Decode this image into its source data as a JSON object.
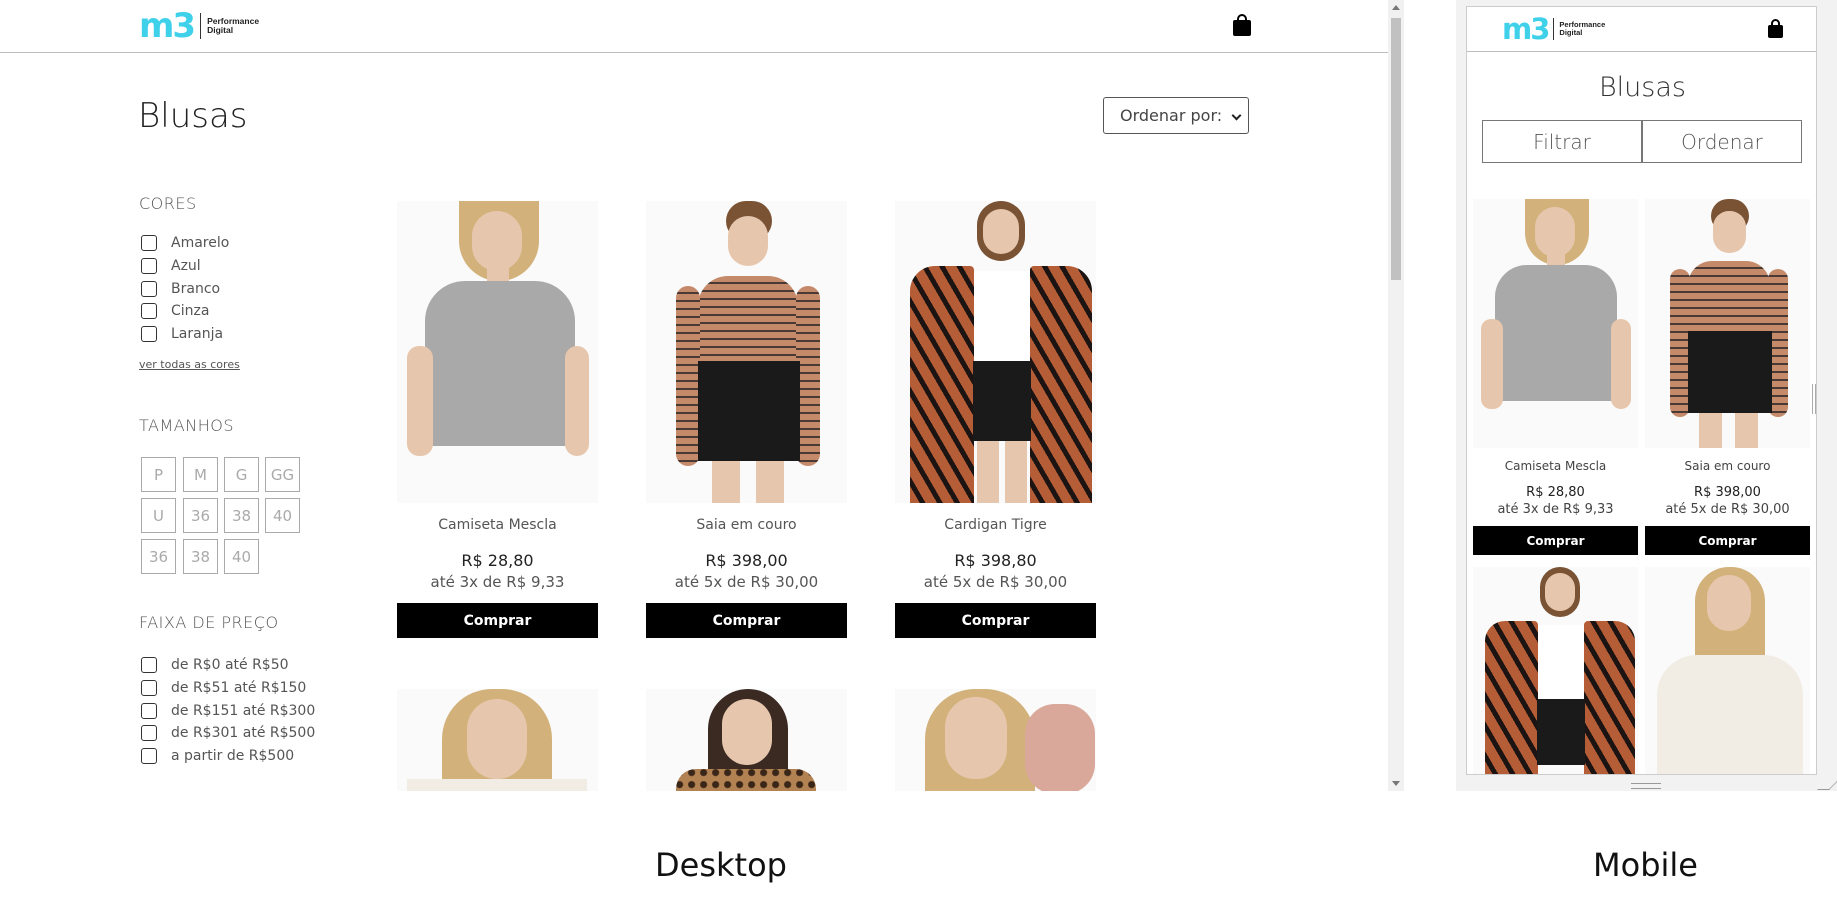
{
  "logo": {
    "mark": "m3",
    "line1": "Performance",
    "line2": "Digital"
  },
  "icons": {
    "bag": "shopping-bag-icon",
    "chevron": "chevron-down-icon"
  },
  "desktop": {
    "title": "Blusas",
    "sort_label": "Ordenar por:",
    "colors": {
      "heading": "CORES",
      "options": [
        "Amarelo",
        "Azul",
        "Branco",
        "Cinza",
        "Laranja"
      ],
      "see_all": "ver todas as cores"
    },
    "sizes": {
      "heading": "TAMANHOS",
      "options": [
        "P",
        "M",
        "G",
        "GG",
        "U",
        "36",
        "38",
        "40",
        "36",
        "38",
        "40"
      ]
    },
    "price": {
      "heading": "FAIXA DE PREÇO",
      "options": [
        "de R$0 até R$50",
        "de R$51 até R$150",
        "de R$151 até R$300",
        "de R$301 até R$500",
        "a partir de R$500"
      ]
    },
    "products": [
      {
        "name": "Camiseta Mescla",
        "price": "R$ 28,80",
        "installments": "até 3x de R$ 9,33",
        "buy": "Comprar"
      },
      {
        "name": "Saia em couro",
        "price": "R$ 398,00",
        "installments": "até 5x de R$ 30,00",
        "buy": "Comprar"
      },
      {
        "name": "Cardigan Tigre",
        "price": "R$ 398,80",
        "installments": "até 5x de R$ 30,00",
        "buy": "Comprar"
      }
    ]
  },
  "mobile": {
    "title": "Blusas",
    "filter_label": "Filtrar",
    "order_label": "Ordenar",
    "products": [
      {
        "name": "Camiseta Mescla",
        "price": "R$ 28,80",
        "installments": "até 3x de R$ 9,33",
        "buy": "Comprar"
      },
      {
        "name": "Saia em couro",
        "price": "R$ 398,00",
        "installments": "até 5x de R$ 30,00",
        "buy": "Comprar"
      }
    ]
  },
  "captions": {
    "desktop": "Desktop",
    "mobile": "Mobile"
  },
  "colors": {
    "brand": "#3fd0ea",
    "button": "#000000"
  }
}
